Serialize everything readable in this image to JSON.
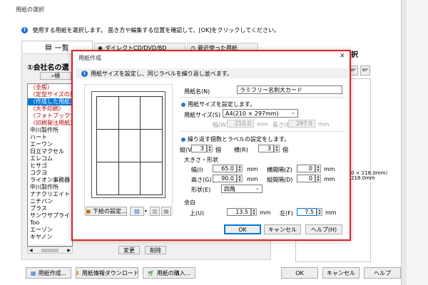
{
  "main": {
    "title": "用紙の選択",
    "instruction": "使用する用紙を選択します。 面き方や編集する位置を確認して、[OK]をクリックしてください。",
    "tabs": [
      "一覧",
      "ダイレクトCD/DVD/BD",
      "最近使った用紙"
    ],
    "company_label": "①会社名の選",
    "search_label": "検",
    "right_heading": "択",
    "preview_size_label": "0 × 218.0mm）",
    "preview_size_label2": "218.0mm",
    "list_items": [
      {
        "label": "〈全般〉",
        "state": "hl"
      },
      {
        "label": "〈定型サイズの用紙",
        "state": "hl"
      },
      {
        "label": "〈作成した用紙〉",
        "state": "sel"
      },
      {
        "label": "〈大手印刷〉",
        "state": "hl"
      },
      {
        "label": "〈フォトブックサー",
        "state": "hl"
      },
      {
        "label": "〈印刷発注用紙〉",
        "state": "hl"
      },
      {
        "label": "中川製作所",
        "state": ""
      },
      {
        "label": "ハート",
        "state": ""
      },
      {
        "label": "エーワン",
        "state": ""
      },
      {
        "label": "日立マクセル",
        "state": ""
      },
      {
        "label": "エレコム",
        "state": ""
      },
      {
        "label": "ヒサゴ",
        "state": ""
      },
      {
        "label": "コクヨ",
        "state": ""
      },
      {
        "label": "ライオン事務器",
        "state": ""
      },
      {
        "label": "中川製作所",
        "state": ""
      },
      {
        "label": "ナナクリエイト",
        "state": ""
      },
      {
        "label": "ニチバン",
        "state": ""
      },
      {
        "label": "プラス",
        "state": ""
      },
      {
        "label": "サンワサプライ",
        "state": ""
      },
      {
        "label": "Too",
        "state": ""
      },
      {
        "label": "エーゾン",
        "state": ""
      },
      {
        "label": "キヤノン",
        "state": ""
      }
    ],
    "change_btn": "変更",
    "delete_btn": "削除",
    "create_paper_btn": "用紙作成...",
    "download_btn": "用紙情報ダウンロード",
    "buy_btn": "用紙の購入...",
    "ok_btn": "OK",
    "cancel_btn": "キャンセル",
    "help_btn": "ヘルプ",
    "rotate_left_label": "90°",
    "rotate_right_label": "90°"
  },
  "dialog": {
    "title": "用紙作成",
    "close": "✕",
    "instruction": "用紙サイズを設定し、同じラベルを繰り返し並べます。",
    "paper_name_label": "用紙名(N)",
    "paper_name_value": "ラミフリー名刺大カード",
    "size_section": "用紙サイズを設定します。",
    "paper_size_label": "用紙サイズ(S)",
    "paper_size_value": "A4(210 × 297mm)",
    "width_label": "幅(W)",
    "width_value": "210.0",
    "height_label": "長さ(E)",
    "height_value": "297.0",
    "unit_mm": "mm",
    "repeat_section": "繰り返す個数とラベルの設定をします。",
    "rows_label": "縦(V)",
    "rows_value": "3",
    "cols_label": "横(R)",
    "cols_value": "3",
    "count_unit": "個",
    "size_shape_label": "大きさ・形状",
    "label_width_label": "幅(I)",
    "label_width_value": "65.0",
    "h_gap_label": "横間隔(Z)",
    "h_gap_value": "0",
    "label_height_label": "高さ(G)",
    "label_height_value": "90.0",
    "v_gap_label": "縦間隔(D)",
    "v_gap_value": "0",
    "shape_label": "形状(E)",
    "shape_value": "四角",
    "margin_label": "余白",
    "top_label": "上(U)",
    "top_value": "13.5",
    "left_label": "左(F)",
    "left_value": "7.5",
    "underlay_btn": "下絵の設定...",
    "ok_btn": "OK",
    "cancel_btn": "キャンセル",
    "help_btn": "ヘルプ(H)",
    "preview_rows": 3,
    "preview_cols": 3
  },
  "colors": {
    "accent_red": "#e02020",
    "selection_blue": "#0078d7",
    "info_blue": "#1e73d2"
  }
}
